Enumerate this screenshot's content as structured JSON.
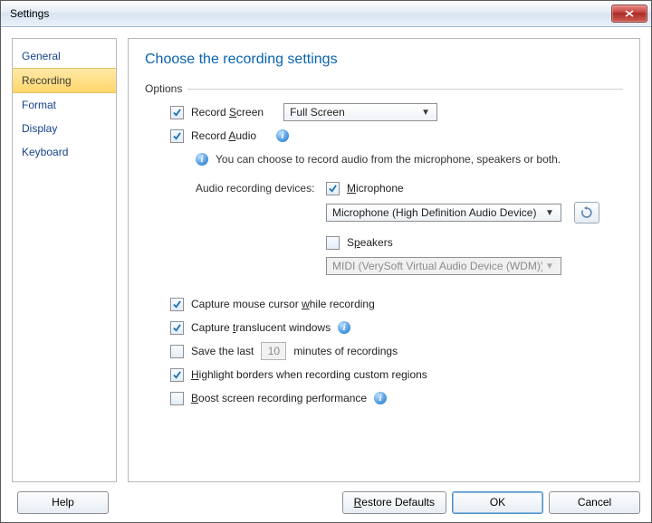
{
  "window": {
    "title": "Settings"
  },
  "sidebar": {
    "items": [
      {
        "label": "General"
      },
      {
        "label": "Recording",
        "selected": true
      },
      {
        "label": "Format"
      },
      {
        "label": "Display"
      },
      {
        "label": "Keyboard"
      }
    ]
  },
  "page": {
    "title": "Choose the recording settings",
    "group_label": "Options"
  },
  "options": {
    "record_screen": {
      "label_pre": "Record ",
      "label_u": "S",
      "label_post": "creen",
      "checked": true
    },
    "screen_mode": {
      "value": "Full Screen"
    },
    "record_audio": {
      "label_pre": "Record ",
      "label_u": "A",
      "label_post": "udio",
      "checked": true
    },
    "audio_hint": "You can choose to record audio from the microphone, speakers or both.",
    "devices_label": "Audio recording devices:",
    "microphone": {
      "label_u": "M",
      "label_post": "icrophone",
      "checked": true,
      "value": "Microphone (High Definition Audio Device)"
    },
    "speakers": {
      "label_pre": "S",
      "label_u": "p",
      "label_post": "eakers",
      "checked": false,
      "value": "MIDI (VerySoft Virtual Audio Device (WDM))"
    },
    "capture_cursor": {
      "label_pre": "Capture mouse cursor ",
      "label_u": "w",
      "label_post": "hile recording",
      "checked": true
    },
    "capture_translucent": {
      "label_pre": "Capture ",
      "label_u": "t",
      "label_post": "ranslucent windows",
      "checked": true
    },
    "save_last": {
      "label_pre": "Save the last",
      "label_post": "minutes of recordings",
      "checked": false,
      "minutes": "10"
    },
    "highlight_borders": {
      "label_u": "H",
      "label_post": "ighlight borders when recording custom regions",
      "checked": true
    },
    "boost_perf": {
      "label_u": "B",
      "label_post": "oost screen recording performance",
      "checked": false
    }
  },
  "footer": {
    "help": "Help",
    "restore_pre": "",
    "restore_u": "R",
    "restore_post": "estore Defaults",
    "ok": "OK",
    "cancel": "Cancel"
  }
}
